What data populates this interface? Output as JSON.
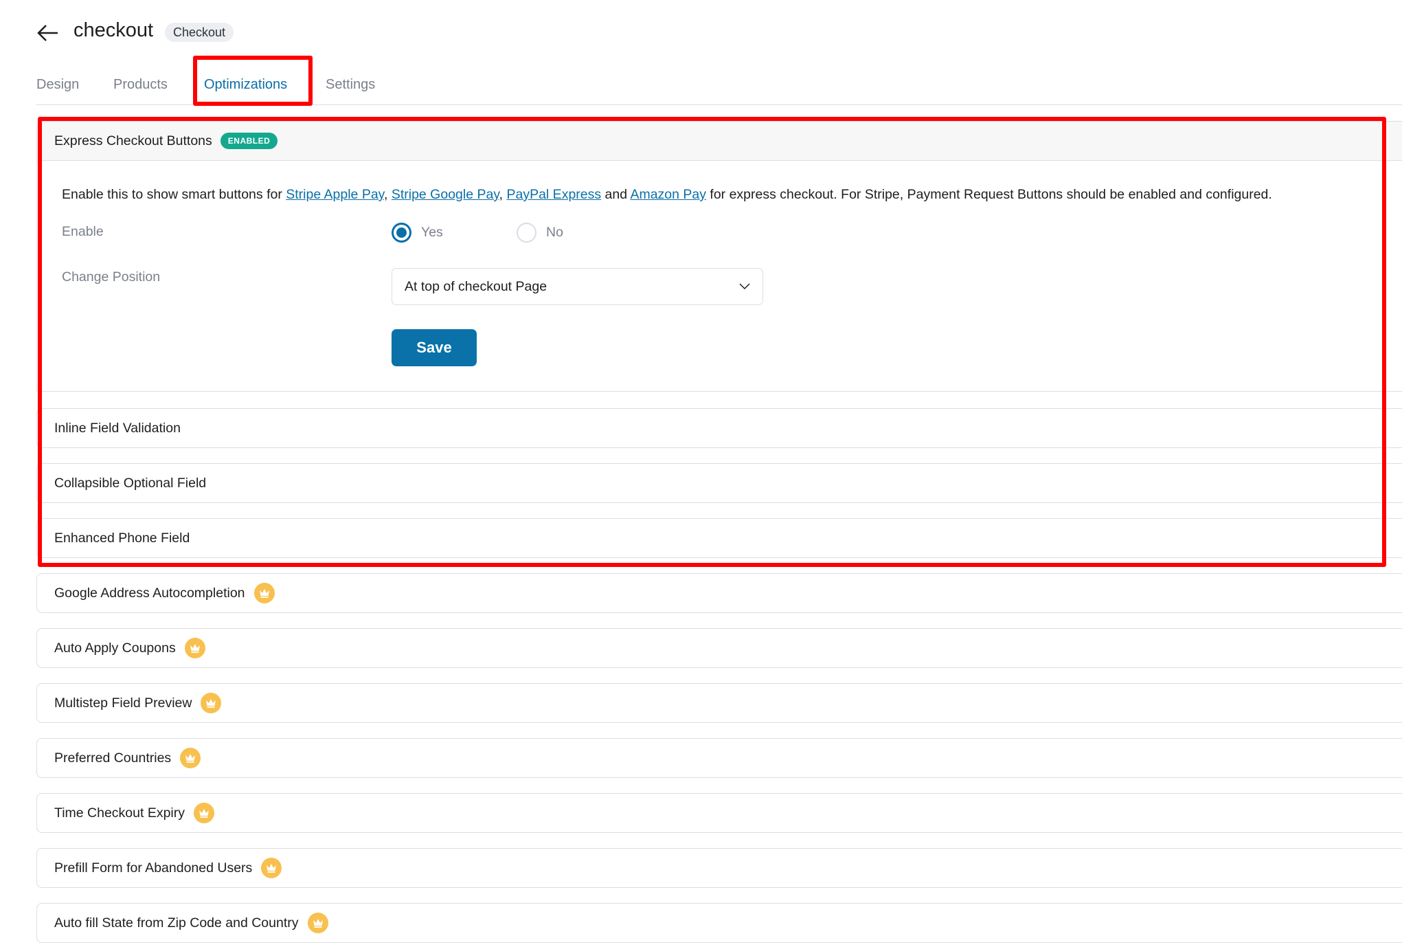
{
  "header": {
    "title": "checkout",
    "type_badge": "Checkout"
  },
  "tabs": [
    {
      "label": "Design"
    },
    {
      "label": "Products"
    },
    {
      "label": "Optimizations",
      "active": true
    },
    {
      "label": "Settings"
    }
  ],
  "express": {
    "title": "Express Checkout Buttons",
    "badge": "ENABLED",
    "desc_pre": "Enable this to show smart buttons for ",
    "links": [
      "Stripe Apple Pay",
      "Stripe Google Pay",
      "PayPal Express",
      "Amazon Pay"
    ],
    "sep1": ", ",
    "sep2": ", ",
    "sep3": " and ",
    "desc_post": " for express checkout. For Stripe, Payment Request Buttons should be enabled and configured.",
    "enable_label": "Enable",
    "yes": "Yes",
    "no": "No",
    "selected": "Yes",
    "position_label": "Change Position",
    "position_value": "At top of checkout Page",
    "save": "Save"
  },
  "sections": [
    {
      "title": "Inline Field Validation",
      "pro": false
    },
    {
      "title": "Collapsible Optional Field",
      "pro": false
    },
    {
      "title": "Enhanced Phone Field",
      "pro": false
    },
    {
      "title": "Google Address Autocompletion",
      "pro": true
    },
    {
      "title": "Auto Apply Coupons",
      "pro": true
    },
    {
      "title": "Multistep Field Preview",
      "pro": true
    },
    {
      "title": "Preferred Countries",
      "pro": true
    },
    {
      "title": "Time Checkout Expiry",
      "pro": true
    },
    {
      "title": "Prefill Form for Abandoned Users",
      "pro": true
    },
    {
      "title": "Auto fill State from Zip Code and Country",
      "pro": true
    }
  ],
  "colors": {
    "accent": "#0a6fa8",
    "enabled": "#14a88e",
    "crown": "#f8c04f",
    "highlight": "#ff0000"
  }
}
